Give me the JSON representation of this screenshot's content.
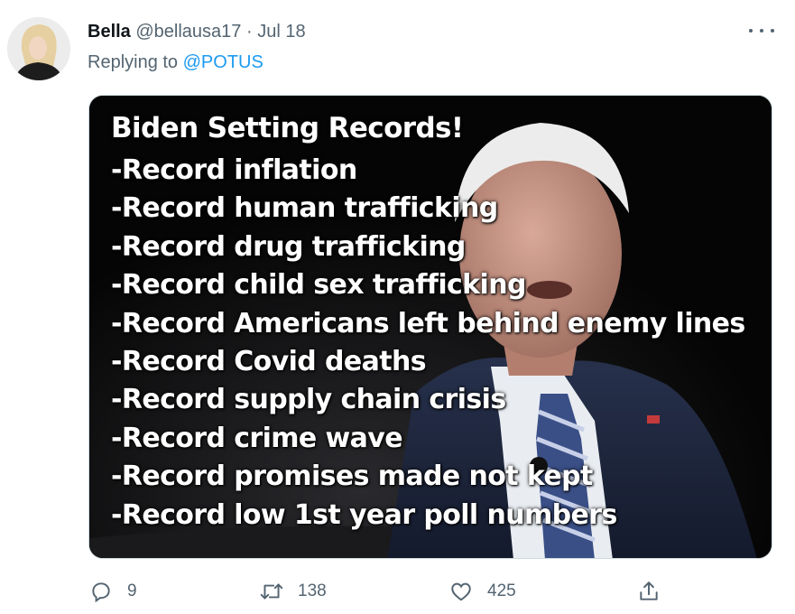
{
  "tweet": {
    "display_name": "Bella",
    "handle": "@bellausa17",
    "separator": "·",
    "date": "Jul 18",
    "replying_prefix": "Replying to",
    "replying_to": "@POTUS",
    "more_icon": "more-horizontal-icon"
  },
  "image": {
    "title": "Biden Setting Records!",
    "lines": [
      "-Record inflation",
      "-Record human trafficking",
      "-Record drug trafficking",
      "-Record child sex trafficking",
      "-Record Americans left behind enemy lines",
      "-Record Covid deaths",
      "-Record supply chain crisis",
      "-Record crime wave",
      "-Record promises made not kept",
      "-Record low 1st year poll numbers"
    ]
  },
  "actions": {
    "reply": {
      "icon": "reply-icon",
      "count": "9"
    },
    "retweet": {
      "icon": "retweet-icon",
      "count": "138"
    },
    "like": {
      "icon": "heart-icon",
      "count": "425"
    },
    "share": {
      "icon": "share-icon"
    }
  },
  "colors": {
    "accent": "#1d9bf0",
    "secondary_text": "#536471",
    "primary_text": "#0f1419"
  }
}
